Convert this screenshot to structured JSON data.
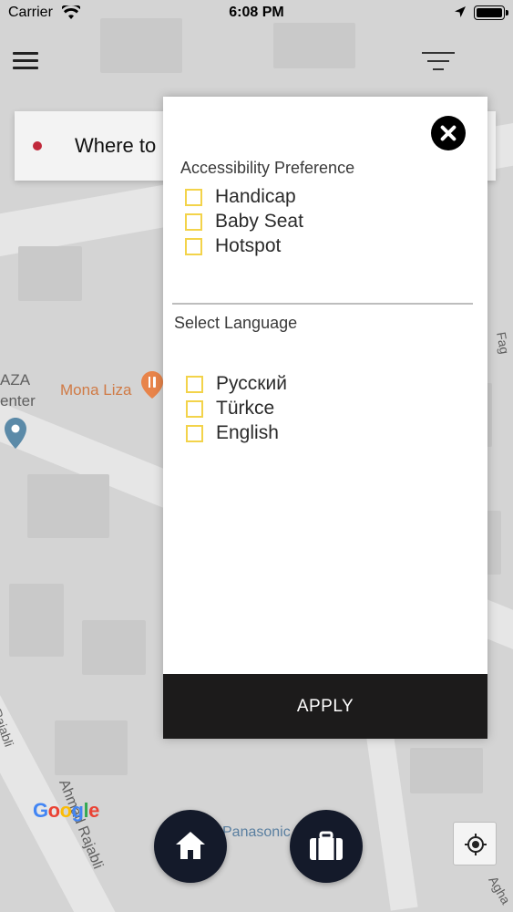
{
  "status_bar": {
    "carrier": "Carrier",
    "time": "6:08 PM"
  },
  "map": {
    "labels": {
      "place_name": "Mona Liza",
      "partial_left_top": "AZA",
      "partial_left_bottom": "enter",
      "street_left": "Ahmad Rajabli",
      "street_left_lower": "Rajabli",
      "place_bottom": "Panasonic",
      "right_edge_top": "Fag",
      "right_edge_bottom": "Agha"
    },
    "google_logo": [
      "G",
      "o",
      "o",
      "g",
      "l",
      "e"
    ],
    "google_colors": [
      "#4285F4",
      "#EA4335",
      "#FBBC05",
      "#4285F4",
      "#34A853",
      "#EA4335"
    ]
  },
  "search": {
    "placeholder": "Where to"
  },
  "filter_modal": {
    "accessibility_title": "Accessibility Preference",
    "accessibility_options": [
      {
        "label": "Handicap",
        "checked": false
      },
      {
        "label": "Baby Seat",
        "checked": false
      },
      {
        "label": "Hotspot",
        "checked": false
      }
    ],
    "language_title": "Select Language",
    "language_options": [
      {
        "label": "Русский",
        "checked": false
      },
      {
        "label": "Türkce",
        "checked": false
      },
      {
        "label": "English",
        "checked": false
      }
    ],
    "apply_label": "APPLY"
  },
  "colors": {
    "checkbox_border": "#f3d34a",
    "apply_bg": "#1c1b1b",
    "round_button_bg": "#141a2a",
    "origin_dot": "#c0283a",
    "poi_orange": "#e8844a",
    "map_pin_blue": "#5b8aa8"
  },
  "icons": {
    "menu": "hamburger-menu-icon",
    "filter": "filter-icon",
    "close": "close-icon",
    "home": "home-icon",
    "bag": "briefcase-icon",
    "gps": "my-location-icon",
    "wifi": "wifi-icon",
    "location": "location-arrow-icon",
    "battery": "battery-icon"
  }
}
